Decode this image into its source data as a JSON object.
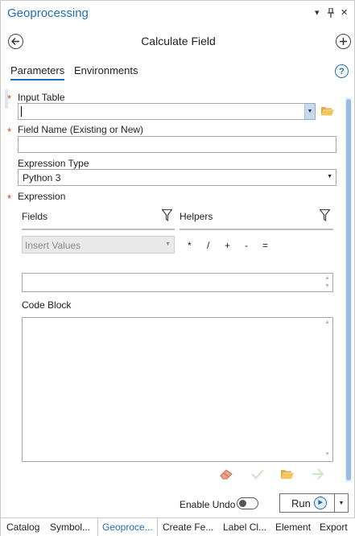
{
  "pane": {
    "title": "Geoprocessing",
    "menu_glyph": "▾",
    "pin_glyph": "📌",
    "close_glyph": "✕"
  },
  "header": {
    "title": "Calculate Field",
    "back_icon": "back-arrow-icon",
    "add_icon": "add-icon"
  },
  "tabs": [
    {
      "label": "Parameters",
      "active": true
    },
    {
      "label": "Environments",
      "active": false
    }
  ],
  "help_glyph": "?",
  "params": {
    "input_table": {
      "label": "Input Table",
      "value": "",
      "required": true
    },
    "field_name": {
      "label": "Field Name (Existing or New)",
      "value": "",
      "required": true
    },
    "expression_type": {
      "label": "Expression Type",
      "value": "Python 3"
    },
    "expression": {
      "label": "Expression",
      "required": true,
      "fields_label": "Fields",
      "helpers_label": "Helpers",
      "insert_values": "Insert Values",
      "operators": [
        "*",
        "/",
        "+",
        "-",
        "="
      ],
      "value": ""
    },
    "code_block": {
      "label": "Code Block",
      "value": ""
    }
  },
  "toolbar_icons": [
    "eraser-icon",
    "check-icon",
    "folder-open-icon",
    "arrow-right-icon"
  ],
  "footer": {
    "enable_undo_label": "Enable Undo",
    "enable_undo_on": false,
    "run_label": "Run"
  },
  "bottom_tabs": [
    {
      "label": "Catalog",
      "active": false
    },
    {
      "label": "Symbol...",
      "active": false
    },
    {
      "label": "Geoproce...",
      "active": true
    },
    {
      "label": "Create Fe...",
      "active": false
    },
    {
      "label": "Label Cl...",
      "active": false
    },
    {
      "label": "Element",
      "active": false
    },
    {
      "label": "Export",
      "active": false
    }
  ],
  "colors": {
    "accent": "#1d6fb8",
    "required_star": "#c8431a",
    "scroll_thumb": "#9bbbe0"
  }
}
